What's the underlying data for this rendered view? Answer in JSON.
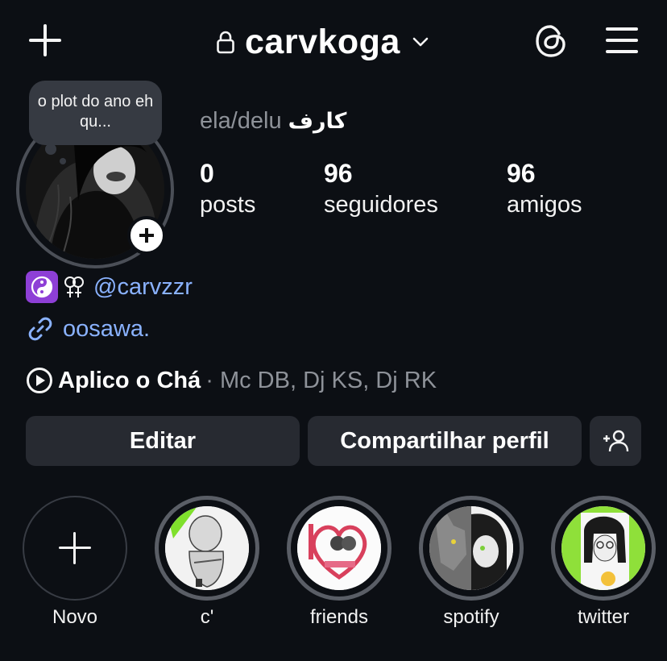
{
  "header": {
    "username": "carvkoga",
    "icons": [
      "plus-icon",
      "lock-icon",
      "chevron-down-icon",
      "threads-icon",
      "menu-icon"
    ]
  },
  "note": {
    "text": "o plot do ano eh qu..."
  },
  "profile": {
    "pronouns": "ela/delu",
    "display_name": "كارف",
    "stats": [
      {
        "value": "0",
        "label": "posts"
      },
      {
        "value": "96",
        "label": "seguidores"
      },
      {
        "value": "96",
        "label": "amigos"
      }
    ]
  },
  "bio": {
    "symbols": "☯",
    "mention": "@carvzzr",
    "link": "oosawa.",
    "song": "Aplico o Chá",
    "artists": " · Mc DB, Dj KS, Dj RK"
  },
  "buttons": {
    "edit": "Editar",
    "share": "Compartilhar perfil"
  },
  "highlights": [
    {
      "label": "Novo"
    },
    {
      "label": "c'"
    },
    {
      "label": "friends"
    },
    {
      "label": "spotify"
    },
    {
      "label": "twitter"
    }
  ],
  "colors": {
    "background": "#0c0f14",
    "button": "#272a31",
    "link": "#8ab2ff",
    "muted": "#8e9299",
    "accent_purple": "#8e3fd6"
  }
}
